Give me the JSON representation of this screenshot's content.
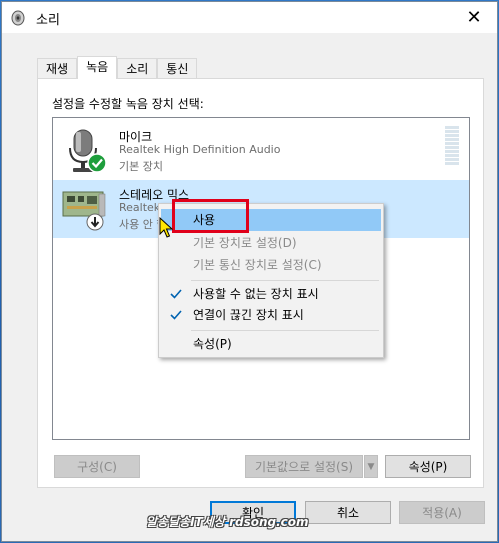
{
  "window": {
    "title": "소리",
    "close_glyph": "✕"
  },
  "tabs": [
    {
      "label": "재생"
    },
    {
      "label": "녹음"
    },
    {
      "label": "소리"
    },
    {
      "label": "통신"
    }
  ],
  "panel": {
    "label": "설정을 수정할 녹음 장치 선택:"
  },
  "devices": [
    {
      "name": "마이크",
      "driver": "Realtek High Definition Audio",
      "status": "기본 장치",
      "icon": "microphone-icon",
      "badge": "default-check-badge"
    },
    {
      "name": "스테레오 믹스",
      "driver": "Realtek High Definition Audio",
      "status": "사용 안 함",
      "icon": "sound-card-icon",
      "badge": "disabled-down-badge"
    }
  ],
  "buttons": {
    "configure": "구성(C)",
    "set_default": "기본값으로 설정(S)",
    "properties": "속성(P)",
    "ok": "확인",
    "cancel": "취소",
    "apply": "적용(A)"
  },
  "context_menu": {
    "items": [
      {
        "label": "사용",
        "state": "hover"
      },
      {
        "label": "기본 장치로 설정(D)",
        "state": "disabled"
      },
      {
        "label": "기본 통신 장치로 설정(C)",
        "state": "disabled"
      },
      {
        "label": "사용할 수 없는 장치 표시",
        "checked": true
      },
      {
        "label": "연결이 끊긴 장치 표시",
        "checked": true
      },
      {
        "label": "속성(P)"
      }
    ]
  },
  "watermark": "알송달송IT세상 rdsong.com",
  "colors": {
    "selection": "#cce8ff",
    "menu_hover": "#91c9f7",
    "accent": "#0078d7",
    "highlight": "#e0001a",
    "check_green": "#1e9e3c"
  }
}
